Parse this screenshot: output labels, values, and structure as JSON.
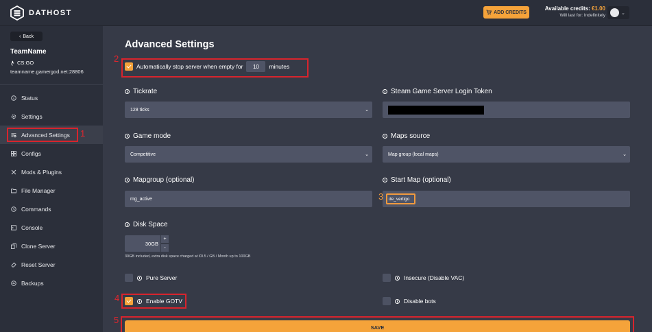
{
  "topbar": {
    "brand": "DATHOST",
    "add_credits_label": "ADD CREDITS",
    "credits_label": "Available credits:",
    "credits_amount": "€1.00",
    "credits_duration": "Will last for: Indefinitely"
  },
  "sidebar": {
    "back_label": "Back",
    "server_name": "TeamName",
    "server_game": "CS:GO",
    "server_host": "teamname.gamergod.net:28806",
    "items": [
      {
        "label": "Status",
        "icon": "info-circle-icon"
      },
      {
        "label": "Settings",
        "icon": "gear-icon"
      },
      {
        "label": "Advanced Settings",
        "icon": "sliders-icon"
      },
      {
        "label": "Configs",
        "icon": "grid-icon"
      },
      {
        "label": "Mods & Plugins",
        "icon": "tools-icon"
      },
      {
        "label": "File Manager",
        "icon": "folder-icon"
      },
      {
        "label": "Commands",
        "icon": "clock-icon"
      },
      {
        "label": "Console",
        "icon": "terminal-icon"
      },
      {
        "label": "Clone Server",
        "icon": "copy-icon"
      },
      {
        "label": "Reset Server",
        "icon": "eraser-icon"
      },
      {
        "label": "Backups",
        "icon": "cloud-icon"
      }
    ]
  },
  "main": {
    "title": "Advanced Settings",
    "auto_stop": {
      "prefix": "Automatically stop server when empty for",
      "value": "10",
      "suffix": "minutes"
    },
    "tickrate": {
      "label": "Tickrate",
      "value": "128 ticks"
    },
    "token": {
      "label": "Steam Game Server Login Token"
    },
    "game_mode": {
      "label": "Game mode",
      "value": "Competitive"
    },
    "maps_source": {
      "label": "Maps source",
      "value": "Map group (local maps)"
    },
    "mapgroup": {
      "label": "Mapgroup (optional)",
      "value": "mg_active"
    },
    "start_map": {
      "label": "Start Map (optional)",
      "value": "de_vertigo"
    },
    "disk": {
      "label": "Disk Space",
      "value": "30",
      "unit": "GB",
      "plus": "+",
      "minus": "-",
      "note": "30GB included, extra disk space charged at €0.5 / GB / Month up to 100GB"
    },
    "pure_server": "Pure Server",
    "insecure": "Insecure (Disable VAC)",
    "gotv": "Enable GOTV",
    "disable_bots": "Disable bots",
    "save_label": "SAVE"
  },
  "annotations": [
    "1",
    "2",
    "3",
    "4",
    "5"
  ],
  "colors": {
    "accent": "#f5a33a",
    "annotation_red": "#d8242d",
    "annotation_orange": "#f19a3e"
  }
}
